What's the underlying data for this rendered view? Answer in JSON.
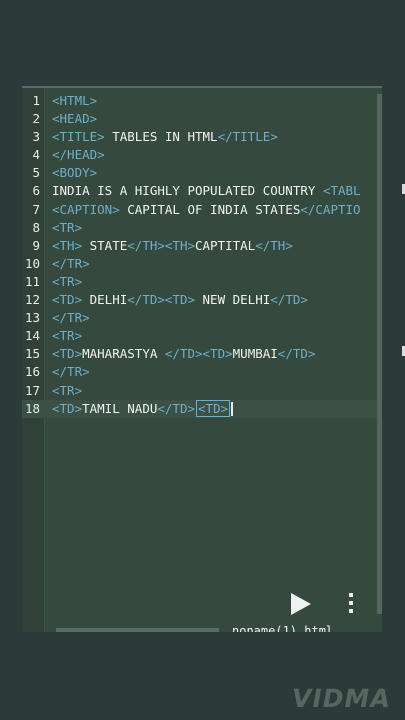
{
  "editor": {
    "lines": [
      {
        "num": "1",
        "parts": [
          [
            "tag",
            "<HTML>"
          ]
        ]
      },
      {
        "num": "2",
        "parts": [
          [
            "tag",
            "<HEAD>"
          ]
        ]
      },
      {
        "num": "3",
        "parts": [
          [
            "tag",
            "<TITLE>"
          ],
          [
            "text",
            " TABLES IN HTML"
          ],
          [
            "tag",
            "</TITLE>"
          ]
        ]
      },
      {
        "num": "4",
        "parts": [
          [
            "tag",
            "</HEAD>"
          ]
        ]
      },
      {
        "num": "5",
        "parts": [
          [
            "tag",
            "<BODY>"
          ]
        ]
      },
      {
        "num": "6",
        "parts": [
          [
            "text",
            "INDIA IS A HIGHLY POPULATED COUNTRY "
          ],
          [
            "tag",
            "<TABL"
          ]
        ]
      },
      {
        "num": "7",
        "parts": [
          [
            "tag",
            "<CAPTION>"
          ],
          [
            "text",
            " CAPITAL OF INDIA STATES"
          ],
          [
            "tag",
            "</CAPTIO"
          ]
        ]
      },
      {
        "num": "8",
        "parts": [
          [
            "tag",
            "<TR>"
          ]
        ]
      },
      {
        "num": "9",
        "parts": [
          [
            "tag",
            "<TH>"
          ],
          [
            "text",
            " STATE"
          ],
          [
            "tag",
            "</TH><TH>"
          ],
          [
            "text",
            "CAPTITAL"
          ],
          [
            "tag",
            "</TH>"
          ]
        ]
      },
      {
        "num": "10",
        "parts": [
          [
            "tag",
            "</TR>"
          ]
        ]
      },
      {
        "num": "11",
        "parts": [
          [
            "tag",
            "<TR>"
          ]
        ]
      },
      {
        "num": "12",
        "parts": [
          [
            "tag",
            "<TD>"
          ],
          [
            "text",
            " DELHI"
          ],
          [
            "tag",
            "</TD><TD>"
          ],
          [
            "text",
            " NEW DELHI"
          ],
          [
            "tag",
            "</TD>"
          ]
        ]
      },
      {
        "num": "13",
        "parts": [
          [
            "tag",
            "</TR>"
          ]
        ]
      },
      {
        "num": "14",
        "parts": [
          [
            "tag",
            "<TR>"
          ]
        ]
      },
      {
        "num": "15",
        "parts": [
          [
            "tag",
            "<TD>"
          ],
          [
            "text",
            "MAHARASTYA "
          ],
          [
            "tag",
            "</TD><TD>"
          ],
          [
            "text",
            "MUMBAI"
          ],
          [
            "tag",
            "</TD>"
          ]
        ]
      },
      {
        "num": "16",
        "parts": [
          [
            "tag",
            "</TR>"
          ]
        ]
      },
      {
        "num": "17",
        "parts": [
          [
            "tag",
            "<TR>"
          ]
        ]
      },
      {
        "num": "18",
        "parts": [
          [
            "tag",
            "<TD>"
          ],
          [
            "text",
            "TAMIL NADU"
          ],
          [
            "tag",
            "</TD>"
          ],
          [
            "cursor",
            "<TD>"
          ]
        ]
      }
    ],
    "active_line": 18
  },
  "bottom_bar": {
    "play_icon": "play-icon",
    "menu_icon": "more-vertical-icon",
    "filename": "noname(1).html"
  },
  "watermark": "VIDMA",
  "colors": {
    "background": "#2c3b3a",
    "editor_bg": "#36493f",
    "tag": "#6fb0c7",
    "text": "#f2f5f3"
  }
}
